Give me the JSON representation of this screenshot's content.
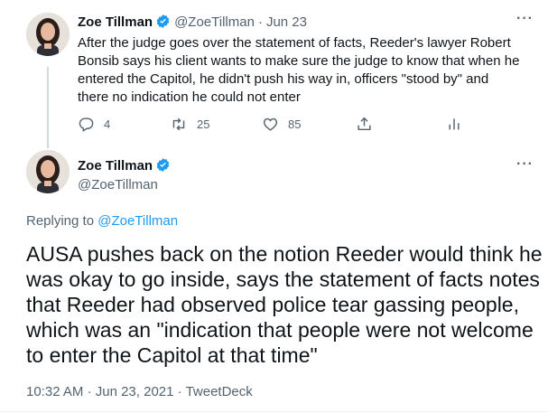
{
  "tweet1": {
    "name": "Zoe Tillman",
    "handle": "@ZoeTillman",
    "separator": "·",
    "date": "Jun 23",
    "more": "···",
    "lines": [
      "After the judge goes over the statement of facts, Reeder's lawyer Robert",
      "Bonsib says his client wants to make sure the judge to know that when he",
      "entered the Capitol, he didn't push his way in, officers \"stood by\" and",
      "there no indication he could not enter"
    ],
    "actions": {
      "reply_count": "4",
      "retweet_count": "25",
      "like_count": "85"
    }
  },
  "tweet2": {
    "name": "Zoe Tillman",
    "handle": "@ZoeTillman",
    "more": "···",
    "replying_prefix": "Replying to",
    "replying_to": "@ZoeTillman",
    "lines": [
      "AUSA pushes back on the notion Reeder would think he",
      "was okay to go inside, says the statement of facts notes",
      "that Reeder had observed police tear gassing people,",
      "which was an \"indication that people were not welcome",
      "to enter the Capitol at that time\""
    ],
    "time": "10:32 AM",
    "meta_sep1": "·",
    "date": "Jun 23, 2021",
    "meta_sep2": "·",
    "source": "TweetDeck"
  },
  "colors": {
    "accent": "#1d9bf0",
    "secondary_text": "#536471",
    "primary_text": "#0f1419"
  }
}
